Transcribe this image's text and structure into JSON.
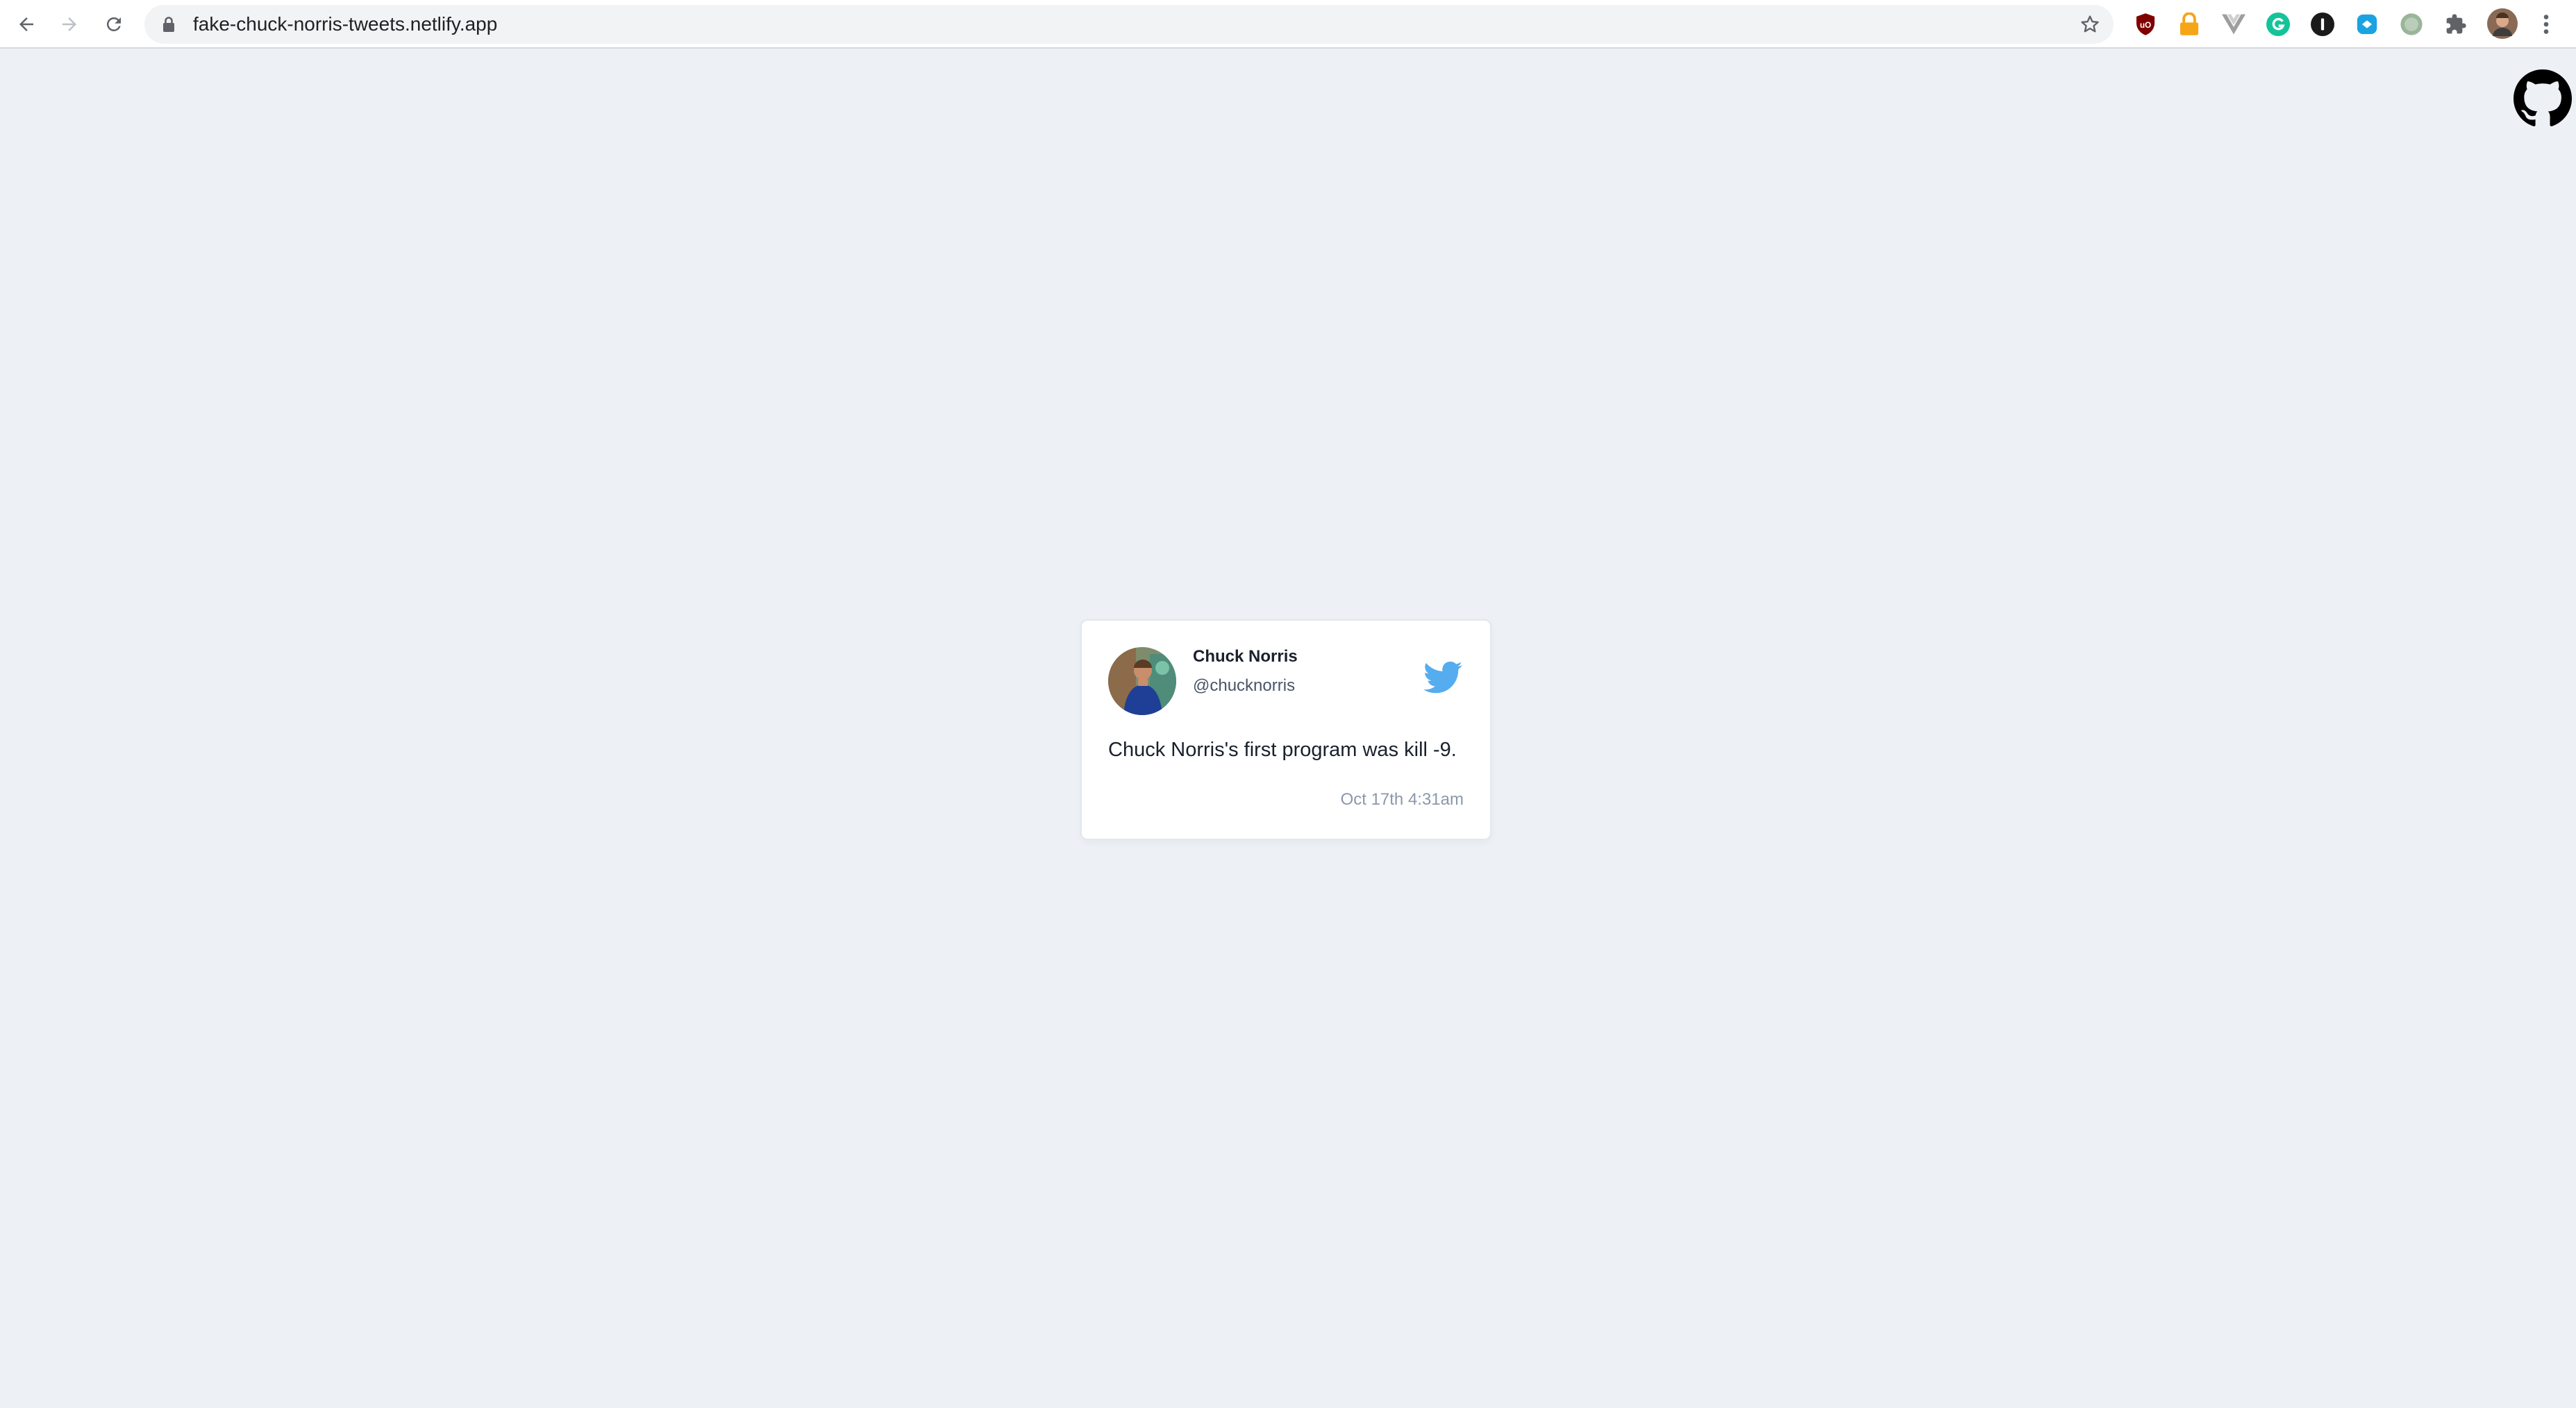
{
  "browser": {
    "url": "fake-chuck-norris-tweets.netlify.app",
    "extensions": [
      {
        "icon": "ublock-icon",
        "color": "#800000"
      },
      {
        "icon": "padlock-extension-icon",
        "color": "#f6a516"
      },
      {
        "icon": "vue-devtools-icon",
        "color": "#9e9e9e"
      },
      {
        "icon": "grammarly-icon",
        "color": "#15c39a"
      },
      {
        "icon": "onepassword-icon",
        "color": "#1a1a1a"
      },
      {
        "icon": "extension-blue-icon",
        "color": "#1aa3e0"
      },
      {
        "icon": "extension-grey-circle-icon",
        "color": "#9ab59a"
      }
    ]
  },
  "page": {
    "background": "#edf1f5",
    "github_corner": {
      "icon": "github-icon"
    }
  },
  "tweet": {
    "name": "Chuck Norris",
    "handle": "@chucknorris",
    "text": "Chuck Norris's first program was kill -9.",
    "timestamp": "Oct 17th 4:31am",
    "brand_color": "#55acee",
    "bird_icon": "twitter-bird-icon",
    "avatar": "profile-avatar"
  }
}
